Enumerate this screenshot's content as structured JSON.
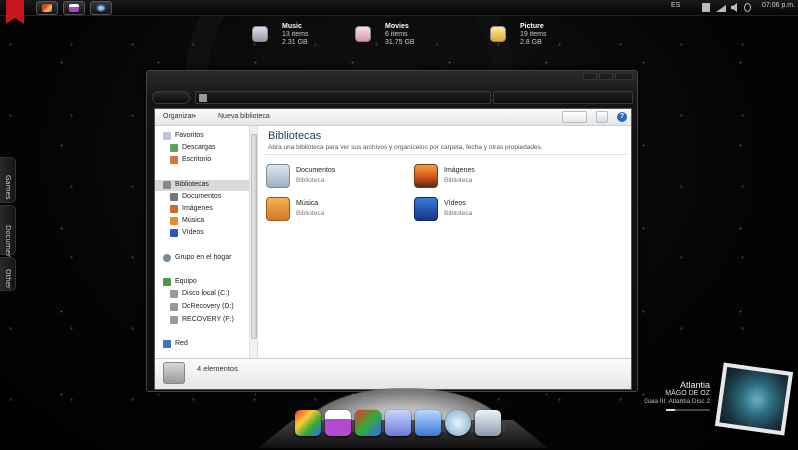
{
  "taskbar": {
    "language": "ES",
    "clock": "07:06 p.m."
  },
  "libraries_summary": [
    {
      "name": "Music",
      "items": "13 items",
      "size": "2.31 GB",
      "icon": "music-library-icon",
      "color": "#3a5fb0"
    },
    {
      "name": "Movies",
      "items": "6 items",
      "size": "31.75 GB",
      "icon": "movies-library-icon",
      "color": "#b0307a"
    },
    {
      "name": "Picture",
      "items": "19 items",
      "size": "2.8 GB",
      "icon": "pictures-library-icon",
      "color": "#e2a21a"
    }
  ],
  "side_tabs": [
    "Games",
    "Documents",
    "Other"
  ],
  "explorer": {
    "toolbar": {
      "organize": "Organizar",
      "new_library": "Nueva biblioteca"
    },
    "nav": {
      "favorites": "Favoritos",
      "downloads": "Descargas",
      "desktop": "Escritorio",
      "libraries": "Bibliotecas",
      "documents": "Documentos",
      "pictures": "Imágenes",
      "music": "Música",
      "videos": "Vídeos",
      "homegroup": "Grupo en el hogar",
      "computer": "Equipo",
      "drive_c": "Disco local (C:)",
      "drive_d": "DcRecovery (D:)",
      "drive_f": "RECOVERY (F:)",
      "network": "Red"
    },
    "content": {
      "title": "Bibliotecas",
      "subtitle": "Abra una biblioteca para ver sus archivos y organícelos por carpeta, fecha y otras propiedades.",
      "libraries": [
        {
          "name": "Documentos",
          "type": "Biblioteca"
        },
        {
          "name": "Imágenes",
          "type": "Biblioteca"
        },
        {
          "name": "Música",
          "type": "Biblioteca"
        },
        {
          "name": "Vídeos",
          "type": "Biblioteca"
        }
      ]
    },
    "details": {
      "count": "4 elementos"
    }
  },
  "now_playing": {
    "artist": "Atlantia",
    "band": "MÄGO DE OZ",
    "album": "Gaia III: Atlantia Disc 2",
    "progress": 0.2
  }
}
